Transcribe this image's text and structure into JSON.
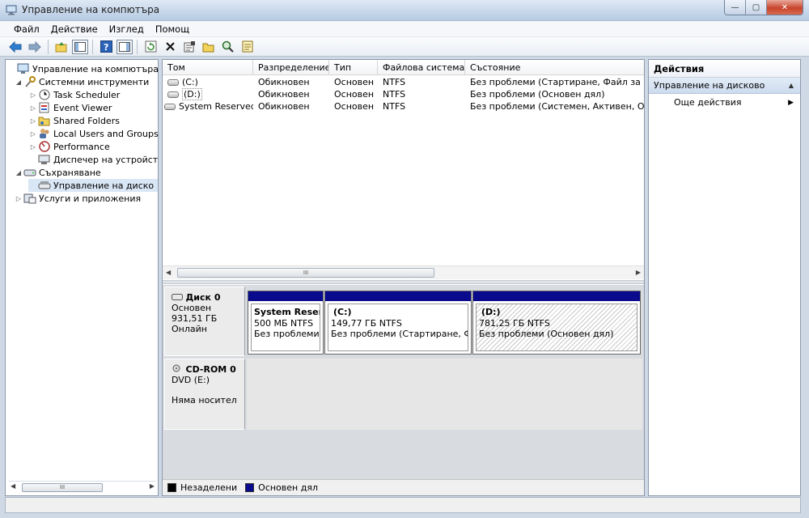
{
  "window": {
    "title": "Управление на компютъра",
    "minimize_glyph": "—",
    "maximize_glyph": "▢",
    "close_glyph": "✕"
  },
  "menu": [
    "Файл",
    "Действие",
    "Изглед",
    "Помощ"
  ],
  "toolbar": {
    "icons": [
      "back-arrow-icon",
      "forward-arrow-icon",
      "up-folder-icon",
      "show-hide-tree-icon",
      "help-icon",
      "action-pane-icon",
      "refresh-icon",
      "delete-icon",
      "properties-icon",
      "open-folder-icon",
      "search-disk-icon",
      "export-icon"
    ]
  },
  "tree": {
    "root": "Управление на компютъра (л",
    "system_tools": "Системни инструменти",
    "task_scheduler": "Task Scheduler",
    "event_viewer": "Event Viewer",
    "shared_folders": "Shared Folders",
    "local_users": "Local Users and Groups",
    "performance": "Performance",
    "device_manager": "Диспечер на устройст",
    "storage": "Съхраняване",
    "disk_management": "Управление на диско",
    "services": "Услуги и приложения",
    "scroll_grip": "III"
  },
  "volume_table": {
    "columns": [
      "Том",
      "Разпределение",
      "Тип",
      "Файлова система",
      "Състояние"
    ],
    "rows": [
      [
        "(C:)",
        "Обикновен",
        "Основен",
        "NTFS",
        "Без проблеми (Стартиране, Файл за ви"
      ],
      [
        "(D:)",
        "Обикновен",
        "Основен",
        "NTFS",
        "Без проблеми (Основен дял)"
      ],
      [
        "System Reserved",
        "Обикновен",
        "Основен",
        "NTFS",
        "Без проблеми (Системен, Активен, Осн"
      ]
    ],
    "scroll_grip": "III"
  },
  "disks": {
    "disk0": {
      "name": "Диск 0",
      "type": "Основен",
      "size": "931,51 ГБ",
      "status": "Онлайн",
      "partitions": [
        {
          "name": "System Reserv",
          "size": "500 МБ NTFS",
          "status": "Без проблеми"
        },
        {
          "name": "(C:)",
          "size": "149,77 ГБ NTFS",
          "status": "Без проблеми (Стартиране, Фа"
        },
        {
          "name": "(D:)",
          "size": "781,25 ГБ NTFS",
          "status": "Без проблеми (Основен дял)"
        }
      ]
    },
    "cdrom0": {
      "name": "CD-ROM 0",
      "type": "DVD (E:)",
      "media": "Няма носител"
    }
  },
  "legend": {
    "unallocated": "Незаделени",
    "primary": "Основен дял",
    "unallocated_color": "#000000",
    "primary_color": "#0a0a8c"
  },
  "actions": {
    "header": "Действия",
    "section": "Управление на дисково",
    "more": "Още действия"
  }
}
